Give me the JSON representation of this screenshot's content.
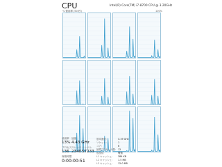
{
  "header": {
    "title": "CPU",
    "cpu_model": "Intel(R) Core(TM) i7-8700 CPU @ 3.20GHz",
    "sub_label": "% 使用率 (60 秒)",
    "max_label": "100%"
  },
  "colors": {
    "accent": "#3f9fce",
    "fill": "#d2e8f3",
    "border": "#9fc6dc",
    "bg": "#f4f9fc"
  },
  "graphs": [
    [
      0,
      0,
      0,
      0,
      0,
      0,
      0,
      0,
      0,
      0,
      0,
      0,
      0,
      0,
      0,
      0,
      0,
      0,
      0,
      0,
      0,
      0,
      0,
      2,
      18,
      4,
      0,
      0,
      2,
      48,
      8,
      0,
      0,
      0,
      0,
      0,
      0,
      3,
      0,
      0
    ],
    [
      0,
      0,
      0,
      0,
      0,
      0,
      0,
      0,
      0,
      0,
      0,
      0,
      0,
      0,
      0,
      0,
      0,
      0,
      0,
      0,
      0,
      0,
      0,
      2,
      28,
      6,
      0,
      0,
      3,
      88,
      10,
      0,
      0,
      0,
      2,
      22,
      4,
      0,
      2,
      0
    ],
    [
      0,
      0,
      0,
      0,
      0,
      0,
      0,
      0,
      0,
      0,
      0,
      0,
      0,
      0,
      0,
      0,
      0,
      0,
      0,
      0,
      0,
      0,
      0,
      2,
      15,
      4,
      0,
      0,
      3,
      70,
      8,
      0,
      0,
      0,
      2,
      42,
      5,
      0,
      3,
      0
    ],
    [
      0,
      0,
      0,
      0,
      0,
      0,
      0,
      0,
      0,
      0,
      0,
      0,
      0,
      0,
      0,
      0,
      0,
      0,
      0,
      0,
      0,
      0,
      0,
      0,
      4,
      1,
      0,
      0,
      2,
      40,
      6,
      0,
      0,
      0,
      2,
      18,
      3,
      0,
      2,
      0
    ],
    [
      0,
      0,
      0,
      0,
      0,
      0,
      0,
      0,
      0,
      0,
      0,
      0,
      0,
      0,
      0,
      0,
      0,
      0,
      0,
      0,
      0,
      0,
      0,
      2,
      32,
      6,
      0,
      0,
      3,
      55,
      8,
      0,
      0,
      0,
      0,
      2,
      0,
      0,
      0,
      0
    ],
    [
      0,
      0,
      0,
      0,
      0,
      0,
      0,
      0,
      0,
      0,
      0,
      0,
      0,
      0,
      0,
      0,
      0,
      0,
      0,
      0,
      0,
      0,
      0,
      2,
      20,
      5,
      0,
      0,
      3,
      60,
      9,
      0,
      0,
      0,
      2,
      18,
      4,
      0,
      2,
      0
    ],
    [
      0,
      0,
      0,
      0,
      0,
      0,
      0,
      0,
      0,
      0,
      0,
      0,
      0,
      0,
      0,
      0,
      0,
      0,
      0,
      0,
      0,
      0,
      0,
      2,
      30,
      6,
      0,
      0,
      3,
      65,
      9,
      0,
      0,
      0,
      2,
      25,
      5,
      0,
      2,
      0
    ],
    [
      0,
      0,
      0,
      0,
      0,
      0,
      0,
      0,
      0,
      0,
      0,
      0,
      0,
      0,
      0,
      0,
      0,
      0,
      0,
      0,
      0,
      0,
      0,
      2,
      22,
      5,
      0,
      0,
      3,
      58,
      8,
      0,
      0,
      0,
      2,
      20,
      4,
      0,
      2,
      0
    ],
    [
      0,
      0,
      0,
      0,
      0,
      0,
      0,
      0,
      0,
      0,
      0,
      0,
      0,
      0,
      0,
      0,
      0,
      0,
      0,
      0,
      0,
      0,
      0,
      2,
      42,
      7,
      0,
      0,
      3,
      82,
      10,
      0,
      0,
      0,
      2,
      52,
      6,
      0,
      3,
      0
    ],
    [
      0,
      0,
      0,
      0,
      0,
      0,
      0,
      0,
      0,
      0,
      0,
      0,
      0,
      0,
      0,
      0,
      0,
      0,
      0,
      0,
      0,
      0,
      0,
      0,
      3,
      1,
      0,
      0,
      2,
      35,
      6,
      0,
      0,
      0,
      2,
      30,
      5,
      0,
      2,
      0
    ],
    [
      0,
      0,
      0,
      0,
      0,
      0,
      0,
      0,
      0,
      0,
      0,
      0,
      0,
      0,
      0,
      0,
      0,
      0,
      0,
      0,
      0,
      0,
      0,
      0,
      2,
      1,
      0,
      0,
      3,
      92,
      12,
      0,
      0,
      0,
      3,
      75,
      9,
      0,
      4,
      0
    ],
    [
      0,
      0,
      0,
      0,
      0,
      0,
      0,
      0,
      0,
      0,
      0,
      0,
      0,
      0,
      0,
      0,
      0,
      0,
      0,
      0,
      0,
      0,
      0,
      0,
      3,
      1,
      0,
      0,
      3,
      78,
      10,
      0,
      0,
      0,
      2,
      38,
      6,
      0,
      3,
      0
    ]
  ],
  "stats": {
    "utilization_label": "使用率",
    "utilization_value": "13%",
    "speed_label": "速度",
    "speed_value": "4.43 GHz",
    "processes_label": "プロセス",
    "processes_value": "136",
    "threads_label": "スレッド",
    "threads_value": "2340",
    "handles_label": "ハンドル",
    "handles_value": "57233",
    "uptime_label": "稼働時間",
    "uptime_value": "0:00:00:51"
  },
  "details": [
    {
      "label": "基本速度:",
      "value": "3.19 GHz"
    },
    {
      "label": "ソケット:",
      "value": "1"
    },
    {
      "label": "コア:",
      "value": "6"
    },
    {
      "label": "論理プロセッサ数:",
      "value": "12"
    },
    {
      "label": "仮想化:",
      "value": "有効"
    },
    {
      "label": "L1 キャッシュ:",
      "value": "384 KB"
    },
    {
      "label": "L2 キャッシュ:",
      "value": "1.5 MB"
    },
    {
      "label": "L3 キャッシュ:",
      "value": "12.0 MB"
    }
  ]
}
